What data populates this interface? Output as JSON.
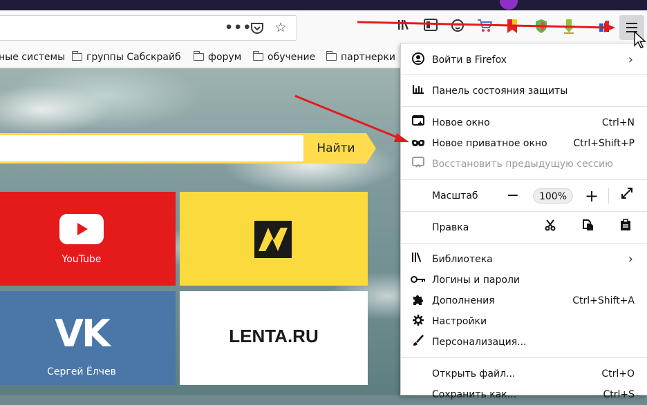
{
  "bookmarks": [
    {
      "label": "ные системы",
      "folder": false
    },
    {
      "label": "группы Сабскрайб",
      "folder": true
    },
    {
      "label": "форум",
      "folder": true
    },
    {
      "label": "обучение",
      "folder": true
    },
    {
      "label": "партнерки",
      "folder": true
    }
  ],
  "urlbar": {
    "more_icon": "•••",
    "pocket_icon": "⊡",
    "star_icon": "☆"
  },
  "toolbar_icons": [
    "library-icon",
    "sidebar-icon",
    "face-icon",
    "cart-icon",
    "bookmark-flag-icon",
    "shield-icon",
    "download-icon",
    "puzzle-icon",
    "hamburger-menu-icon"
  ],
  "search": {
    "button_label": "Найти",
    "query": ""
  },
  "tiles": {
    "youtube_caption": "YouTube",
    "vk_caption": "Сергей Ёлчев",
    "lenta_text": "LENTA.RU"
  },
  "menu": {
    "sign_in": "Войти в Firefox",
    "protection": "Панель состояния защиты",
    "new_window": "Новое окно",
    "new_window_shortcut": "Ctrl+N",
    "private_window": "Новое приватное окно",
    "private_window_shortcut": "Ctrl+Shift+P",
    "restore_session": "Восстановить предыдущую сессию",
    "zoom_label": "Масштаб",
    "zoom_minus": "−",
    "zoom_value": "100%",
    "zoom_plus": "+",
    "edit_label": "Правка",
    "library": "Библиотека",
    "logins": "Логины и пароли",
    "addons": "Дополнения",
    "addons_shortcut": "Ctrl+Shift+A",
    "settings": "Настройки",
    "customize": "Персонализация...",
    "open_file": "Открыть файл...",
    "open_file_shortcut": "Ctrl+O",
    "save_as": "Сохранить как...",
    "save_as_shortcut": "Ctrl+S"
  },
  "colors": {
    "accent_yellow": "#ffdb4d",
    "youtube_red": "#e51a1a",
    "vk_blue": "#4a76a8",
    "annotation_red": "#e31b1b"
  }
}
